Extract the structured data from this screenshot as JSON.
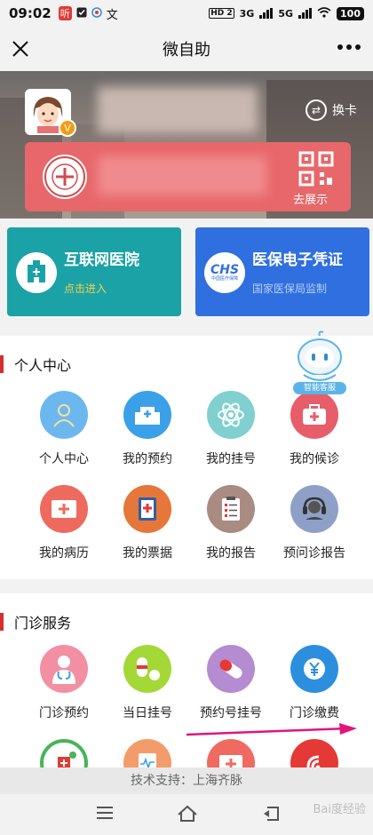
{
  "status_bar": {
    "time": "09:02",
    "left_icons": [
      "news-icon",
      "check-icon",
      "app-icon",
      "text-icon"
    ],
    "news_label": "听",
    "text_label": "文",
    "network_1": "HD 2",
    "signal_1": "3G",
    "signal_2": "5G",
    "battery": "100"
  },
  "title_bar": {
    "title": "微自助"
  },
  "hero": {
    "switch_card_label": "换卡",
    "qr_label": "去展示",
    "avatar_badge": "V"
  },
  "cards": {
    "internet_hospital": {
      "title": "互联网医院",
      "subtitle": "点击进入"
    },
    "insurance": {
      "title": "医保电子凭证",
      "subtitle": "国家医保局监制",
      "logo": "CHS",
      "logo_sub": "中国医疗保障"
    }
  },
  "robot": {
    "label": "智能客服"
  },
  "personal": {
    "title": "个人中心",
    "items": [
      {
        "label": "个人中心",
        "icon": "person-icon",
        "color": "#6cb8ee"
      },
      {
        "label": "我的预约",
        "icon": "building-icon",
        "color": "#3aa0e8"
      },
      {
        "label": "我的挂号",
        "icon": "atom-icon",
        "color": "#7fd0cf"
      },
      {
        "label": "我的候诊",
        "icon": "medkit-icon",
        "color": "#e85d6a"
      },
      {
        "label": "我的病历",
        "icon": "medical-record-icon",
        "color": "#ee6a5e"
      },
      {
        "label": "我的票据",
        "icon": "receipt-icon",
        "color": "#e6773a"
      },
      {
        "label": "我的报告",
        "icon": "clipboard-icon",
        "color": "#a98b82"
      },
      {
        "label": "预问诊报告",
        "icon": "headset-icon",
        "color": "#8fa0c8"
      }
    ]
  },
  "clinic": {
    "title": "门诊服务",
    "items": [
      {
        "label": "门诊预约",
        "icon": "doctor-icon",
        "color": "#f28fa3"
      },
      {
        "label": "当日挂号",
        "icon": "pill-icon",
        "color": "#a4d837"
      },
      {
        "label": "预约号挂号",
        "icon": "capsule-icon",
        "color": "#b58bd2"
      },
      {
        "label": "门诊缴费",
        "icon": "yuan-icon",
        "color": "#2b8fde"
      },
      {
        "label": "",
        "icon": "hospital-green-icon",
        "color": "#47b35a"
      },
      {
        "label": "",
        "icon": "ecg-report-icon",
        "color": "#f39c6b"
      },
      {
        "label": "",
        "icon": "first-aid-icon",
        "color": "#ef6b62"
      },
      {
        "label": "",
        "icon": "wifi-service-icon",
        "color": "#e53935"
      }
    ]
  },
  "footer": {
    "support": "技术支持：上海齐脉",
    "watermark": "Bai度经验"
  },
  "annotation": {
    "arrow_color": "#e0157a"
  }
}
